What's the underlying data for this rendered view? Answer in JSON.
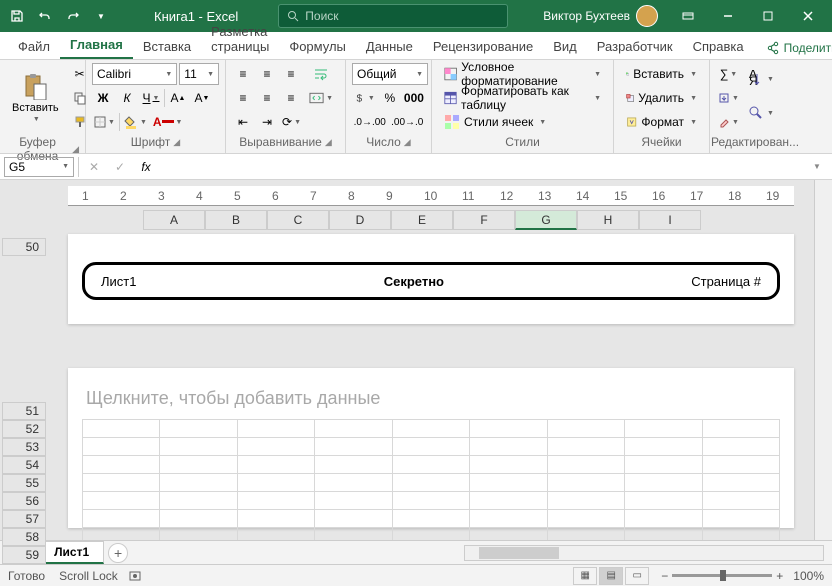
{
  "titlebar": {
    "title": "Книга1 - Excel",
    "search_placeholder": "Поиск",
    "user": "Виктор Бухтеев"
  },
  "tabs": {
    "file": "Файл",
    "home": "Главная",
    "insert": "Вставка",
    "layout": "Разметка страницы",
    "formulas": "Формулы",
    "data": "Данные",
    "review": "Рецензирование",
    "view": "Вид",
    "developer": "Разработчик",
    "help": "Справка",
    "share": "Поделиться"
  },
  "ribbon": {
    "clipboard": {
      "paste": "Вставить",
      "label": "Буфер обмена"
    },
    "font": {
      "name": "Calibri",
      "size": "11",
      "label": "Шрифт",
      "bold": "Ж",
      "italic": "К",
      "underline": "Ч"
    },
    "align": {
      "label": "Выравнивание"
    },
    "number": {
      "format": "Общий",
      "label": "Число"
    },
    "styles": {
      "cond": "Условное форматирование",
      "table": "Форматировать как таблицу",
      "cell": "Стили ячеек",
      "label": "Стили"
    },
    "cells": {
      "insert": "Вставить",
      "delete": "Удалить",
      "format": "Формат",
      "label": "Ячейки"
    },
    "editing": {
      "label": "Редактирован..."
    }
  },
  "formula_bar": {
    "cell": "G5"
  },
  "columns": [
    "A",
    "B",
    "C",
    "D",
    "E",
    "F",
    "G",
    "H",
    "I"
  ],
  "rows_top": [
    "50"
  ],
  "rows_bottom": [
    "51",
    "52",
    "53",
    "54",
    "55",
    "56",
    "57",
    "58",
    "59"
  ],
  "footer": {
    "left": "Лист1",
    "center": "Секретно",
    "right": "Страница #"
  },
  "page2": {
    "placeholder": "Щелкните, чтобы добавить данные"
  },
  "ruler": [
    "1",
    "2",
    "3",
    "4",
    "5",
    "6",
    "7",
    "8",
    "9",
    "10",
    "11",
    "12",
    "13",
    "14",
    "15",
    "16",
    "17",
    "18",
    "19"
  ],
  "sheet_tabs": {
    "sheet1": "Лист1"
  },
  "status": {
    "ready": "Готово",
    "scroll": "Scroll Lock",
    "zoom": "100%"
  }
}
